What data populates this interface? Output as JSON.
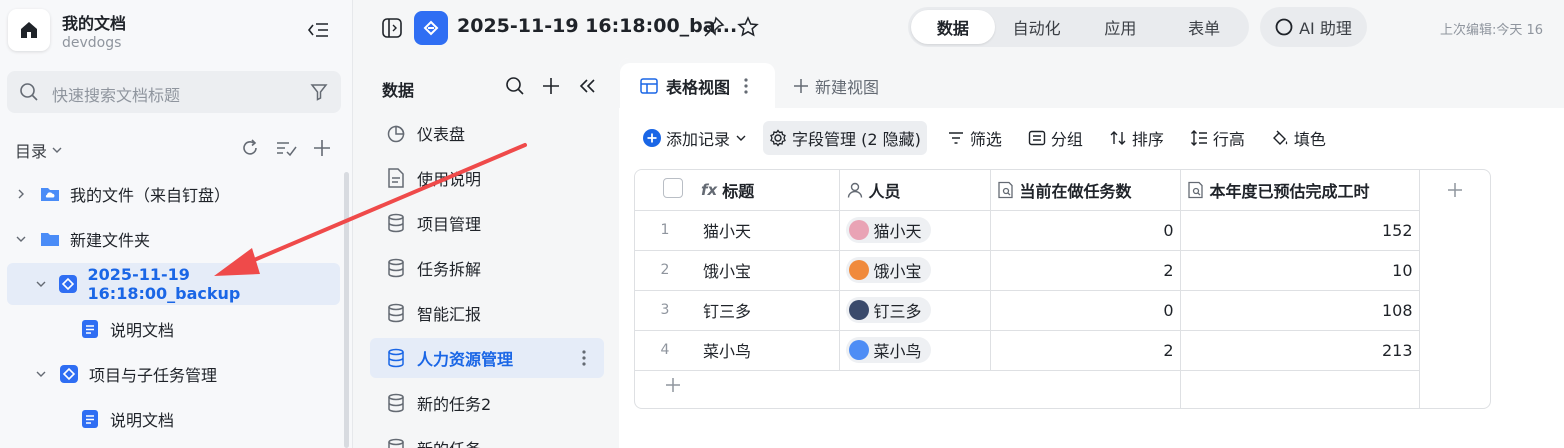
{
  "sidebar": {
    "workspace_title": "我的文档",
    "workspace_sub": "devdogs",
    "search_placeholder": "快速搜索文档标题",
    "dir_label": "目录",
    "tree": [
      {
        "label": "我的文件（来自钉盘）",
        "expanded": false,
        "icon": "cloud-folder-icon",
        "level": 0
      },
      {
        "label": "新建文件夹",
        "expanded": true,
        "icon": "folder-icon",
        "level": 0
      },
      {
        "label": "2025-11-19 16:18:00_backup",
        "expanded": true,
        "icon": "base-app-icon",
        "level": 1,
        "active": true
      },
      {
        "label": "说明文档",
        "icon": "doc-icon",
        "level": 2
      },
      {
        "label": "项目与子任务管理",
        "expanded": true,
        "icon": "base-app-icon",
        "level": 1
      },
      {
        "label": "说明文档",
        "icon": "doc-icon",
        "level": 2
      }
    ]
  },
  "header": {
    "title": "2025-11-19 16:18:00_ba...",
    "mode_tabs": [
      "数据",
      "自动化",
      "应用",
      "表单"
    ],
    "active_mode": "数据",
    "ai_label": "AI 助理",
    "last_edit": "上次编辑:今天 16"
  },
  "data_panel": {
    "title": "数据",
    "items": [
      {
        "label": "仪表盘",
        "icon": "dashboard-icon"
      },
      {
        "label": "使用说明",
        "icon": "doc-outline-icon"
      },
      {
        "label": "项目管理",
        "icon": "database-icon"
      },
      {
        "label": "任务拆解",
        "icon": "database-icon"
      },
      {
        "label": "智能汇报",
        "icon": "database-icon"
      },
      {
        "label": "人力资源管理",
        "icon": "database-icon",
        "active": true
      },
      {
        "label": "新的任务2",
        "icon": "database-icon"
      },
      {
        "label": "新的任务",
        "icon": "database-icon"
      }
    ]
  },
  "main": {
    "view_tab": "表格视图",
    "new_view": "新建视图",
    "toolbar": {
      "add_record": "添加记录",
      "field_manage": "字段管理 (2 隐藏)",
      "filter": "筛选",
      "group": "分组",
      "sort": "排序",
      "row_height": "行高",
      "fill": "填色"
    },
    "columns": [
      "标题",
      "人员",
      "当前在做任务数",
      "本年度已预估完成工时"
    ],
    "rows": [
      {
        "n": "1",
        "title": "猫小天",
        "person": "猫小天",
        "tasks": "0",
        "hours": "152",
        "avatar_color": "#e9a3b5"
      },
      {
        "n": "2",
        "title": "饿小宝",
        "person": "饿小宝",
        "tasks": "2",
        "hours": "10",
        "avatar_color": "#f08a3c"
      },
      {
        "n": "3",
        "title": "钉三多",
        "person": "钉三多",
        "tasks": "0",
        "hours": "108",
        "avatar_color": "#3a4a6b"
      },
      {
        "n": "4",
        "title": "菜小鸟",
        "person": "菜小鸟",
        "tasks": "2",
        "hours": "213",
        "avatar_color": "#4e8df5"
      }
    ]
  },
  "colors": {
    "accent": "#1a66e6",
    "active_bg": "#e5ecf8",
    "arrow": "#ef4a4a"
  }
}
